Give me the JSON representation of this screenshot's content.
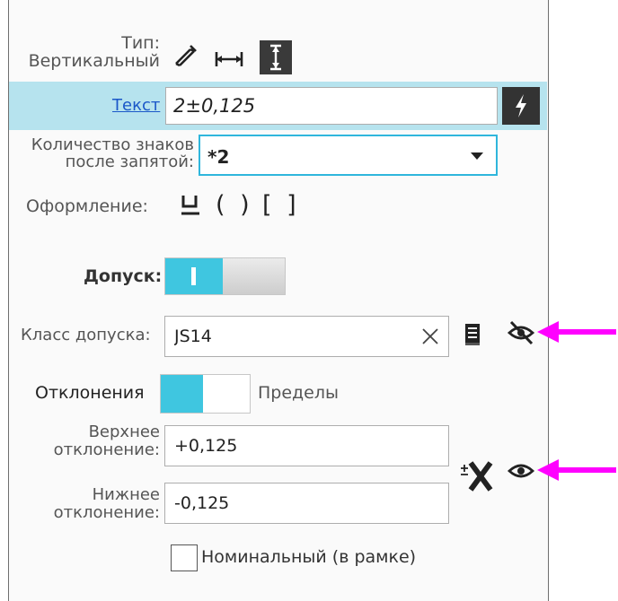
{
  "type_row": {
    "label_line1": "Тип:",
    "label_line2": "Вертикальный"
  },
  "text_row": {
    "link": "Текст",
    "value": "2±0,125"
  },
  "decimals": {
    "label_line1": "Количество знаков",
    "label_line2": "после запятой:",
    "value": "*2"
  },
  "decoration": {
    "label": "Оформление:",
    "brackets_round": "( )",
    "brackets_square": "[ ]"
  },
  "tolerance": {
    "label": "Допуск:",
    "toggle_on": true
  },
  "tolerance_class": {
    "label": "Класс допуска:",
    "value": "JS14"
  },
  "deviations": {
    "left_label": "Отклонения",
    "right_label": "Пределы"
  },
  "upper": {
    "label_line1": "Верхнее",
    "label_line2": "отклонение:",
    "value": "+0,125"
  },
  "lower": {
    "label_line1": "Нижнее",
    "label_line2": "отклонение:",
    "value": "-0,125"
  },
  "nominal": {
    "label": "Номинальный (в рамке)",
    "checked": false
  },
  "colors": {
    "accent": "#3fc6e0",
    "row_highlight": "#b6e3ee",
    "arrow": "#ff00ff"
  }
}
